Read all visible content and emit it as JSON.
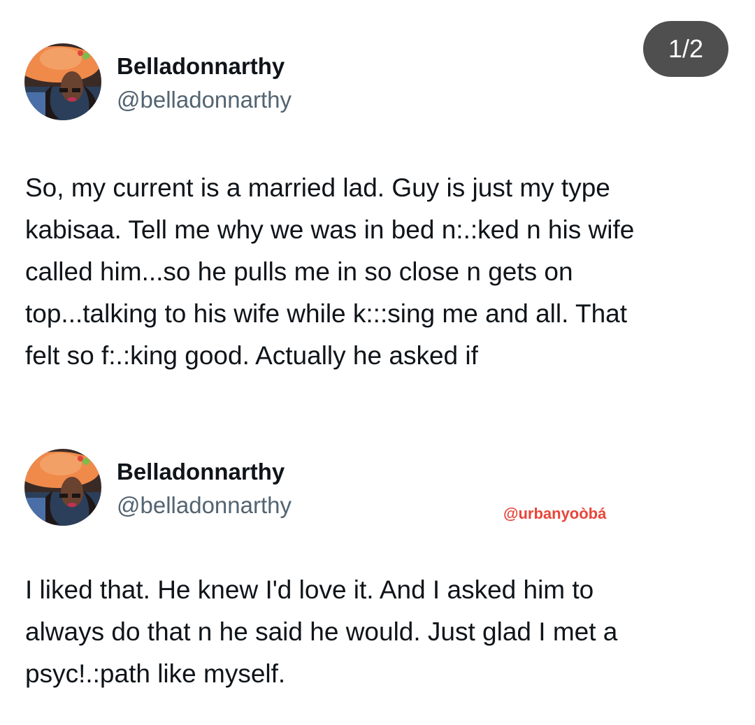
{
  "page_counter": "1/2",
  "tweets": [
    {
      "author": {
        "display_name": "Belladonnarthy",
        "handle": "@belladonnarthy"
      },
      "text_lines": [
        "So, my current is a married lad. Guy is just my type",
        "kabisaa. Tell me why we was in bed n:.:ked n his wife",
        "called him...so he pulls me in so close n gets on",
        "top...talking to his wife while k:::sing me and all. That",
        "felt so f:.:king good. Actually he asked if"
      ]
    },
    {
      "author": {
        "display_name": "Belladonnarthy",
        "handle": "@belladonnarthy"
      },
      "text_lines": [
        "I liked that. He knew I'd love it. And I asked him to",
        "always do that n he said he would.  Just glad I met a",
        "psyc!.:path like myself."
      ]
    }
  ],
  "watermark": "@urbanyoòbá",
  "colors": {
    "text": "#0f1419",
    "handle": "#536471",
    "counter_bg": "#4f4f4f",
    "watermark": "#e8463a"
  },
  "icons": {
    "avatar": "profile-photo-woman-in-orange-hat"
  }
}
